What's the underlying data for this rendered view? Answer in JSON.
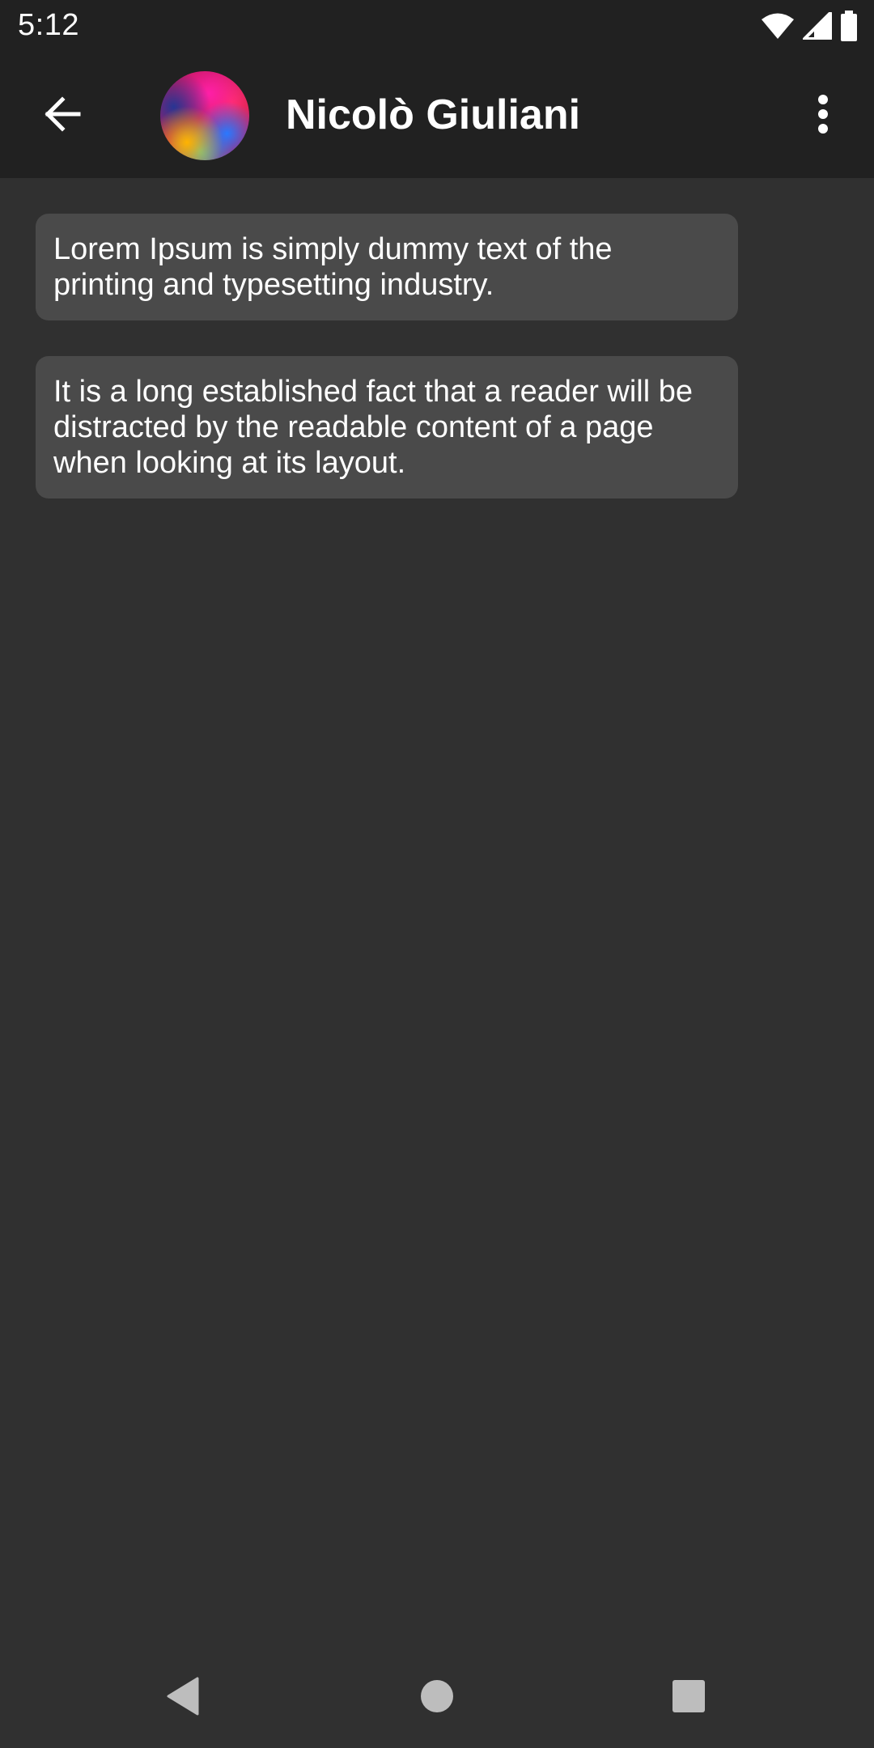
{
  "status_bar": {
    "time": "5:12",
    "icons": [
      "wifi-icon",
      "signal-icon",
      "battery-icon"
    ]
  },
  "app_bar": {
    "back_icon": "arrow-back-icon",
    "contact_name": "Nicolò Giuliani",
    "more_icon": "more-vert-icon"
  },
  "messages": [
    {
      "text": "Lorem Ipsum is simply dummy text of the printing and typesetting industry."
    },
    {
      "text": "It is a long established fact that a reader will be distracted by the readable content of a page when looking at its layout."
    }
  ],
  "nav_bar": {
    "icons": [
      "nav-back-icon",
      "nav-home-icon",
      "nav-recents-icon"
    ]
  },
  "colors": {
    "status_bar_bg": "#212121",
    "app_bar_bg": "#212121",
    "screen_bg": "#303030",
    "bubble_bg": "#4a4a4a",
    "text": "#ffffff",
    "nav_icon": "#bdbdbd"
  }
}
